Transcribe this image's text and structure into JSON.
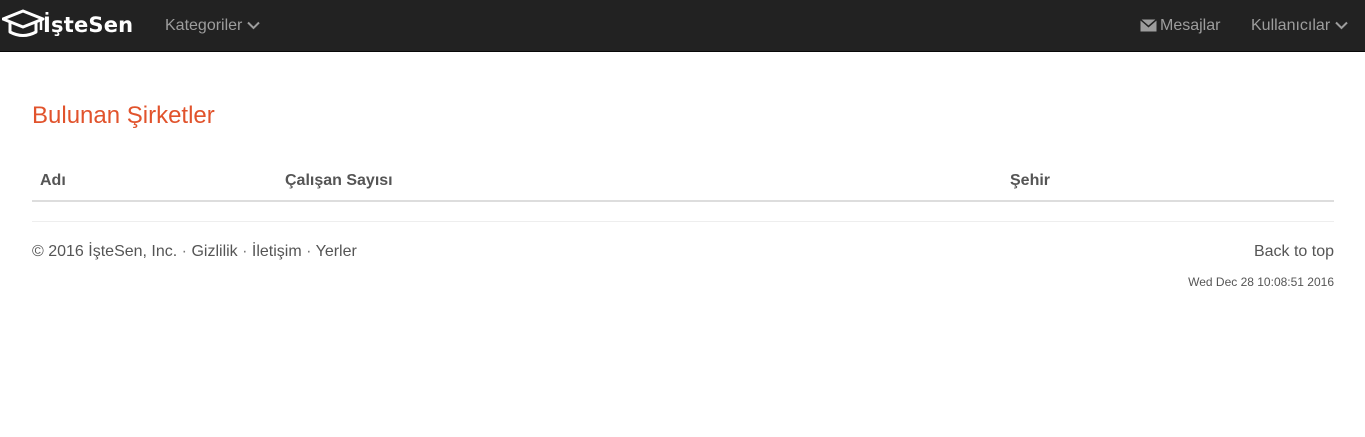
{
  "navbar": {
    "brand": "İşteSen",
    "kategoriler": "Kategoriler",
    "mesajlar": "Mesajlar",
    "kullanicilar": "Kullanıcılar",
    "background": "#222222",
    "link_color": "#9d9d9d"
  },
  "main": {
    "title": "Bulunan Şirketler",
    "title_color": "#e1532c",
    "table": {
      "columns": [
        "Adı",
        "Çalışan Sayısı",
        "Şehir"
      ],
      "rows": []
    }
  },
  "footer": {
    "copyright": "© 2016 İşteSen, Inc.",
    "links": [
      "Gizlilik",
      "İletişim",
      "Yerler"
    ],
    "separator": "·",
    "back_to_top": "Back to top",
    "timestamp": "Wed Dec 28 10:08:51 2016"
  },
  "icons": {
    "brand": "graduation-cap-icon",
    "dropdown": "chevron-down-icon",
    "messages": "envelope-icon"
  }
}
